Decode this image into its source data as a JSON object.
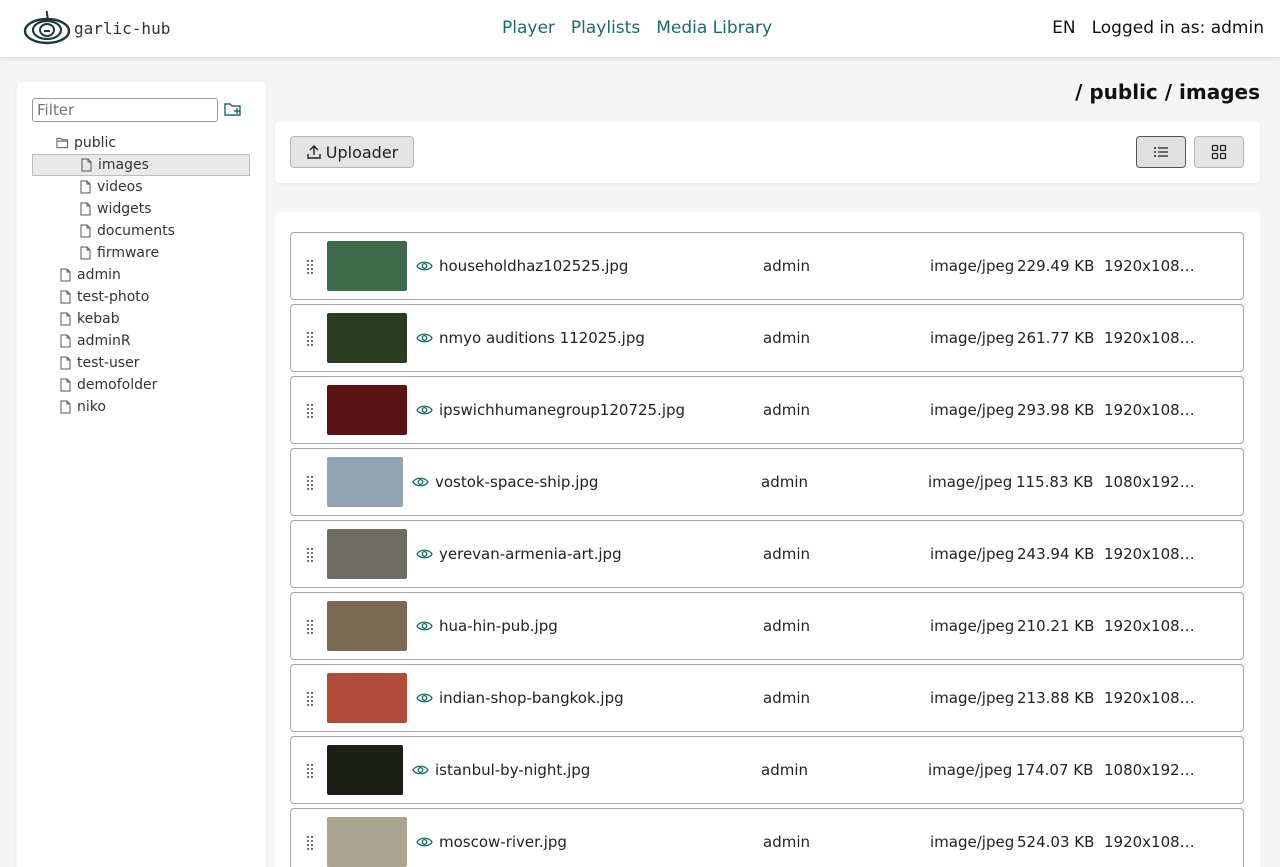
{
  "header": {
    "logo_text": "garlic-hub",
    "nav": [
      "Player",
      "Playlists",
      "Media Library"
    ],
    "lang": "EN",
    "user": "Logged in as: admin"
  },
  "sidebar": {
    "filter_placeholder": "Filter",
    "tree": [
      {
        "label": "public",
        "type": "folder-open"
      },
      {
        "label": "images",
        "type": "file",
        "selected": true
      },
      {
        "label": "videos",
        "type": "file"
      },
      {
        "label": "widgets",
        "type": "file"
      },
      {
        "label": "documents",
        "type": "file"
      },
      {
        "label": "firmware",
        "type": "file"
      },
      {
        "label": "admin",
        "type": "file"
      },
      {
        "label": "test-photo",
        "type": "file"
      },
      {
        "label": "kebab",
        "type": "file"
      },
      {
        "label": "adminR",
        "type": "file"
      },
      {
        "label": "test-user",
        "type": "file"
      },
      {
        "label": "demofolder",
        "type": "file"
      },
      {
        "label": "niko",
        "type": "file"
      }
    ]
  },
  "main": {
    "breadcrumb": "/ public / images",
    "uploader_label": "Uploader",
    "files": [
      {
        "name": "householdhaz102525.jpg",
        "owner": "admin",
        "mime": "image/jpeg",
        "size": "229.49 KB",
        "dims": "1920x108…",
        "thumb": "#3f6b4a"
      },
      {
        "name": "nmyo auditions 112025.jpg",
        "owner": "admin",
        "mime": "image/jpeg",
        "size": "261.77 KB",
        "dims": "1920x108…",
        "thumb": "#2a3d1e"
      },
      {
        "name": "ipswichhumanegroup120725.jpg",
        "owner": "admin",
        "mime": "image/jpeg",
        "size": "293.98 KB",
        "dims": "1920x108…",
        "thumb": "#5a1212"
      },
      {
        "name": "vostok-space-ship.jpg",
        "owner": "admin",
        "mime": "image/jpeg",
        "size": "115.83 KB",
        "dims": "1080x192…",
        "thumb": "#8fa3b3"
      },
      {
        "name": "yerevan-armenia-art.jpg",
        "owner": "admin",
        "mime": "image/jpeg",
        "size": "243.94 KB",
        "dims": "1920x108…",
        "thumb": "#6f6c66"
      },
      {
        "name": "hua-hin-pub.jpg",
        "owner": "admin",
        "mime": "image/jpeg",
        "size": "210.21 KB",
        "dims": "1920x108…",
        "thumb": "#7a6a52"
      },
      {
        "name": "indian-shop-bangkok.jpg",
        "owner": "admin",
        "mime": "image/jpeg",
        "size": "213.88 KB",
        "dims": "1920x108…",
        "thumb": "#b04a3a"
      },
      {
        "name": "istanbul-by-night.jpg",
        "owner": "admin",
        "mime": "image/jpeg",
        "size": "174.07 KB",
        "dims": "1080x192…",
        "thumb": "#1c1f16"
      },
      {
        "name": "moscow-river.jpg",
        "owner": "admin",
        "mime": "image/jpeg",
        "size": "524.03 KB",
        "dims": "1920x108…",
        "thumb": "#a8a58f"
      }
    ]
  },
  "colors": {
    "accent": "#1b6b6b"
  }
}
